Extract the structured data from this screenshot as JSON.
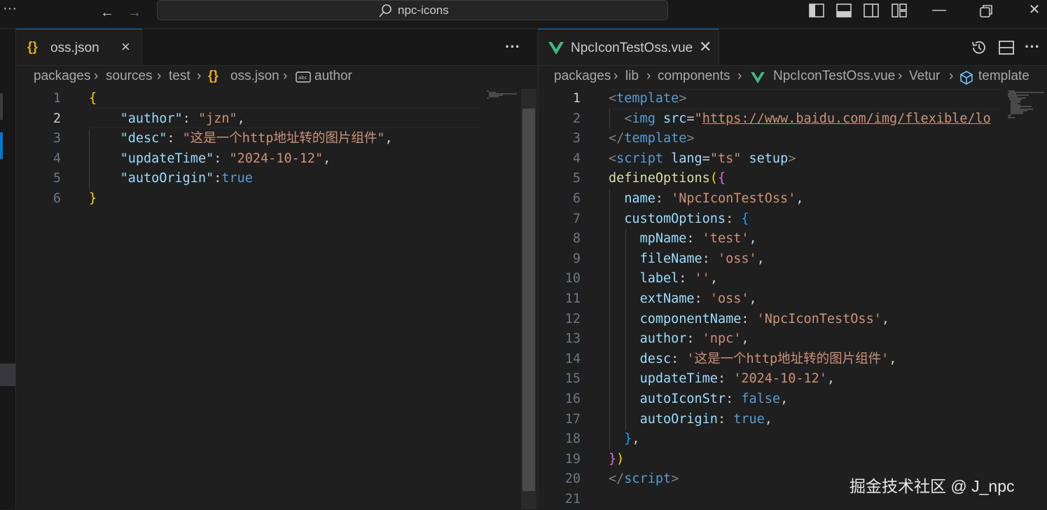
{
  "titlebar": {
    "search_text": "npc-icons",
    "menu_icon": "ellipsis-icon",
    "back_icon": "arrow-left-icon",
    "forward_icon": "arrow-right-icon"
  },
  "left_editor": {
    "tab": {
      "icon": "{}",
      "label": "oss.json",
      "close": "×"
    },
    "more_actions": "···",
    "breadcrumb": [
      "packages",
      "sources",
      "test",
      "oss.json",
      "author"
    ],
    "lines": [
      {
        "n": "1",
        "parts": [
          [
            "br1",
            "{"
          ]
        ]
      },
      {
        "n": "2",
        "parts": [
          [
            "p",
            "    "
          ],
          [
            "k",
            "\"author\""
          ],
          [
            "p",
            ": "
          ],
          [
            "s",
            "\"jzn\""
          ],
          [
            "p",
            ","
          ]
        ]
      },
      {
        "n": "3",
        "parts": [
          [
            "p",
            "    "
          ],
          [
            "k",
            "\"desc\""
          ],
          [
            "p",
            ": "
          ],
          [
            "s",
            "\"这是一个http地址转的图片组件\""
          ],
          [
            "p",
            ","
          ]
        ]
      },
      {
        "n": "4",
        "parts": [
          [
            "p",
            "    "
          ],
          [
            "k",
            "\"updateTime\""
          ],
          [
            "p",
            ": "
          ],
          [
            "s",
            "\"2024-10-12\""
          ],
          [
            "p",
            ","
          ]
        ]
      },
      {
        "n": "5",
        "parts": [
          [
            "p",
            "    "
          ],
          [
            "k",
            "\"autoOrigin\""
          ],
          [
            "p",
            ":"
          ],
          [
            "b",
            "true"
          ]
        ]
      },
      {
        "n": "6",
        "parts": [
          [
            "br1",
            "}"
          ]
        ]
      }
    ],
    "current_line": "2"
  },
  "right_editor": {
    "tab": {
      "icon": "V",
      "label": "NpcIconTestOss.vue",
      "close": "✕"
    },
    "breadcrumb": [
      "packages",
      "lib",
      "components",
      "NpcIconTestOss.vue",
      "Vetur",
      "template"
    ],
    "lines": [
      {
        "n": "1",
        "parts": [
          [
            "tagp",
            "<"
          ],
          [
            "tag",
            "template"
          ],
          [
            "tagp",
            ">"
          ]
        ]
      },
      {
        "n": "2",
        "parts": [
          [
            "p",
            "  "
          ],
          [
            "tagp",
            "<"
          ],
          [
            "tag",
            "img"
          ],
          [
            "p",
            " "
          ],
          [
            "attr",
            "src"
          ],
          [
            "p",
            "="
          ],
          [
            "s",
            "\""
          ],
          [
            "link",
            "https://www.baidu.com/img/flexible/lo"
          ]
        ]
      },
      {
        "n": "3",
        "parts": [
          [
            "tagp",
            "</"
          ],
          [
            "tag",
            "template"
          ],
          [
            "tagp",
            ">"
          ]
        ]
      },
      {
        "n": "4",
        "parts": [
          [
            "tagp",
            "<"
          ],
          [
            "tag",
            "script"
          ],
          [
            "p",
            " "
          ],
          [
            "attr",
            "lang"
          ],
          [
            "p",
            "="
          ],
          [
            "s",
            "\"ts\""
          ],
          [
            "p",
            " "
          ],
          [
            "attr",
            "setup"
          ],
          [
            "tagp",
            ">"
          ]
        ]
      },
      {
        "n": "5",
        "parts": [
          [
            "fn",
            "defineOptions"
          ],
          [
            "br1",
            "("
          ],
          [
            "br2",
            "{"
          ]
        ]
      },
      {
        "n": "6",
        "parts": [
          [
            "p",
            "  "
          ],
          [
            "k",
            "name"
          ],
          [
            "p",
            ": "
          ],
          [
            "s",
            "'NpcIconTestOss'"
          ],
          [
            "p",
            ","
          ]
        ]
      },
      {
        "n": "7",
        "parts": [
          [
            "p",
            "  "
          ],
          [
            "k",
            "customOptions"
          ],
          [
            "p",
            ": "
          ],
          [
            "br3",
            "{"
          ]
        ]
      },
      {
        "n": "8",
        "parts": [
          [
            "p",
            "    "
          ],
          [
            "k",
            "mpName"
          ],
          [
            "p",
            ": "
          ],
          [
            "s",
            "'test'"
          ],
          [
            "p",
            ","
          ]
        ]
      },
      {
        "n": "9",
        "parts": [
          [
            "p",
            "    "
          ],
          [
            "k",
            "fileName"
          ],
          [
            "p",
            ": "
          ],
          [
            "s",
            "'oss'"
          ],
          [
            "p",
            ","
          ]
        ]
      },
      {
        "n": "10",
        "parts": [
          [
            "p",
            "    "
          ],
          [
            "k",
            "label"
          ],
          [
            "p",
            ": "
          ],
          [
            "s",
            "''"
          ],
          [
            "p",
            ","
          ]
        ]
      },
      {
        "n": "11",
        "parts": [
          [
            "p",
            "    "
          ],
          [
            "k",
            "extName"
          ],
          [
            "p",
            ": "
          ],
          [
            "s",
            "'oss'"
          ],
          [
            "p",
            ","
          ]
        ]
      },
      {
        "n": "12",
        "parts": [
          [
            "p",
            "    "
          ],
          [
            "k",
            "componentName"
          ],
          [
            "p",
            ": "
          ],
          [
            "s",
            "'NpcIconTestOss'"
          ],
          [
            "p",
            ","
          ]
        ]
      },
      {
        "n": "13",
        "parts": [
          [
            "p",
            "    "
          ],
          [
            "k",
            "author"
          ],
          [
            "p",
            ": "
          ],
          [
            "s",
            "'npc'"
          ],
          [
            "p",
            ","
          ]
        ]
      },
      {
        "n": "14",
        "parts": [
          [
            "p",
            "    "
          ],
          [
            "k",
            "desc"
          ],
          [
            "p",
            ": "
          ],
          [
            "s",
            "'这是一个http地址转的图片组件'"
          ],
          [
            "p",
            ","
          ]
        ]
      },
      {
        "n": "15",
        "parts": [
          [
            "p",
            "    "
          ],
          [
            "k",
            "updateTime"
          ],
          [
            "p",
            ": "
          ],
          [
            "s",
            "'2024-10-12'"
          ],
          [
            "p",
            ","
          ]
        ]
      },
      {
        "n": "16",
        "parts": [
          [
            "p",
            "    "
          ],
          [
            "k",
            "autoIconStr"
          ],
          [
            "p",
            ": "
          ],
          [
            "b",
            "false"
          ],
          [
            "p",
            ","
          ]
        ]
      },
      {
        "n": "17",
        "parts": [
          [
            "p",
            "    "
          ],
          [
            "k",
            "autoOrigin"
          ],
          [
            "p",
            ": "
          ],
          [
            "b",
            "true"
          ],
          [
            "p",
            ","
          ]
        ]
      },
      {
        "n": "18",
        "parts": [
          [
            "p",
            "  "
          ],
          [
            "br3",
            "}"
          ],
          [
            "p",
            ","
          ]
        ]
      },
      {
        "n": "19",
        "parts": [
          [
            "br2",
            "}"
          ],
          [
            "br1",
            ")"
          ]
        ]
      },
      {
        "n": "20",
        "parts": [
          [
            "tagp",
            "</"
          ],
          [
            "tag",
            "script"
          ],
          [
            "tagp",
            ">"
          ]
        ]
      },
      {
        "n": "21",
        "parts": []
      }
    ],
    "current_line": "1"
  },
  "watermark": "掘金技术社区 @ J_npc",
  "colors": {
    "accent": "#0078d4",
    "vue": "#41b883",
    "json_icon": "#e8ab1c"
  }
}
